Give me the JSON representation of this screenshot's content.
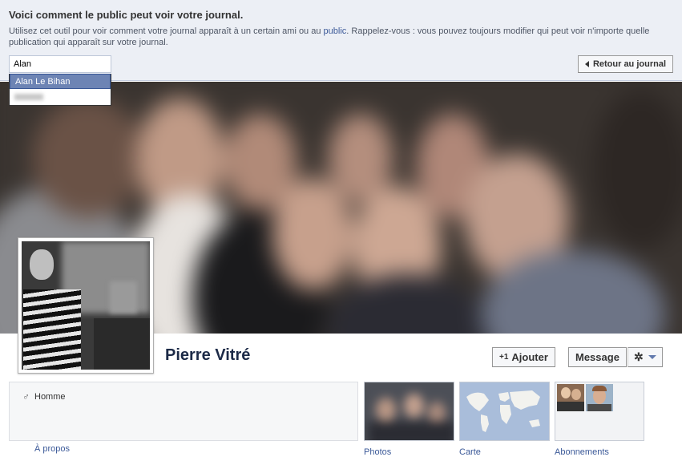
{
  "view_as": {
    "title": "Voici comment le public peut voir votre journal.",
    "desc_before": "Utilisez cet outil pour voir comment votre journal apparaît à un certain ami ou au ",
    "desc_link": "public",
    "desc_after": ". Rappelez-vous : vous pouvez toujours modifier qui peut voir n'importe quelle publication qui apparaît sur votre journal.",
    "search_value": "Alan",
    "suggestions": [
      "Alan Le Bihan"
    ],
    "back_button": "Retour au journal"
  },
  "profile": {
    "name": "Pierre Vitré",
    "add_button": "Ajouter",
    "message_button": "Message",
    "gender": "Homme",
    "about_link": "À propos"
  },
  "tiles": {
    "photos": "Photos",
    "map": "Carte",
    "subscriptions": "Abonnements"
  },
  "colors": {
    "link": "#3b5998",
    "bar_bg": "#eceff5",
    "highlight": "#6d84b4"
  }
}
